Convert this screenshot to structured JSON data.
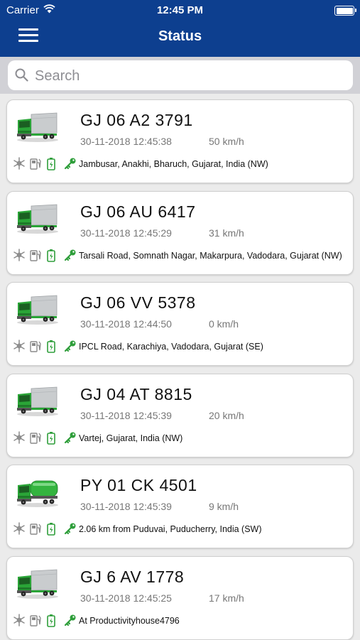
{
  "status_bar": {
    "carrier": "Carrier",
    "time": "12:45 PM"
  },
  "header": {
    "title": "Status"
  },
  "search": {
    "placeholder": "Search"
  },
  "vehicles": [
    {
      "plate": "GJ 06 A2 3791",
      "timestamp": "30-11-2018 12:45:38",
      "speed": "50 km/h",
      "address": "Jambusar, Anakhi, Bharuch, Gujarat, India (NW)",
      "truck_type": "box"
    },
    {
      "plate": "GJ 06 AU 6417",
      "timestamp": "30-11-2018 12:45:29",
      "speed": "31 km/h",
      "address": "Tarsali Road, Somnath Nagar, Makarpura, Vadodara, Gujarat (NW)",
      "truck_type": "box"
    },
    {
      "plate": "GJ 06 VV 5378",
      "timestamp": "30-11-2018 12:44:50",
      "speed": "0 km/h",
      "address": "IPCL Road, Karachiya, Vadodara, Gujarat (SE)",
      "truck_type": "box"
    },
    {
      "plate": "GJ 04 AT 8815",
      "timestamp": "30-11-2018 12:45:39",
      "speed": "20 km/h",
      "address": "Vartej, Gujarat, India (NW)",
      "truck_type": "box"
    },
    {
      "plate": "PY 01 CK 4501",
      "timestamp": "30-11-2018 12:45:39",
      "speed": "9 km/h",
      "address": "2.06 km from Puduvai, Puducherry, India (SW)",
      "truck_type": "tanker"
    },
    {
      "plate": "GJ 6 AV 1778",
      "timestamp": "30-11-2018 12:45:25",
      "speed": "17 km/h",
      "address": "At Productivityhouse4796",
      "truck_type": "box"
    }
  ],
  "status_icons": [
    "snowflake-icon",
    "fuel-pump-icon",
    "battery-icon",
    "ignition-key-icon"
  ],
  "colors": {
    "header": "#0d3f8f",
    "truck_green": "#2aa537",
    "status_green": "#2e9e3a",
    "icon_gray": "#8a8a8a"
  }
}
